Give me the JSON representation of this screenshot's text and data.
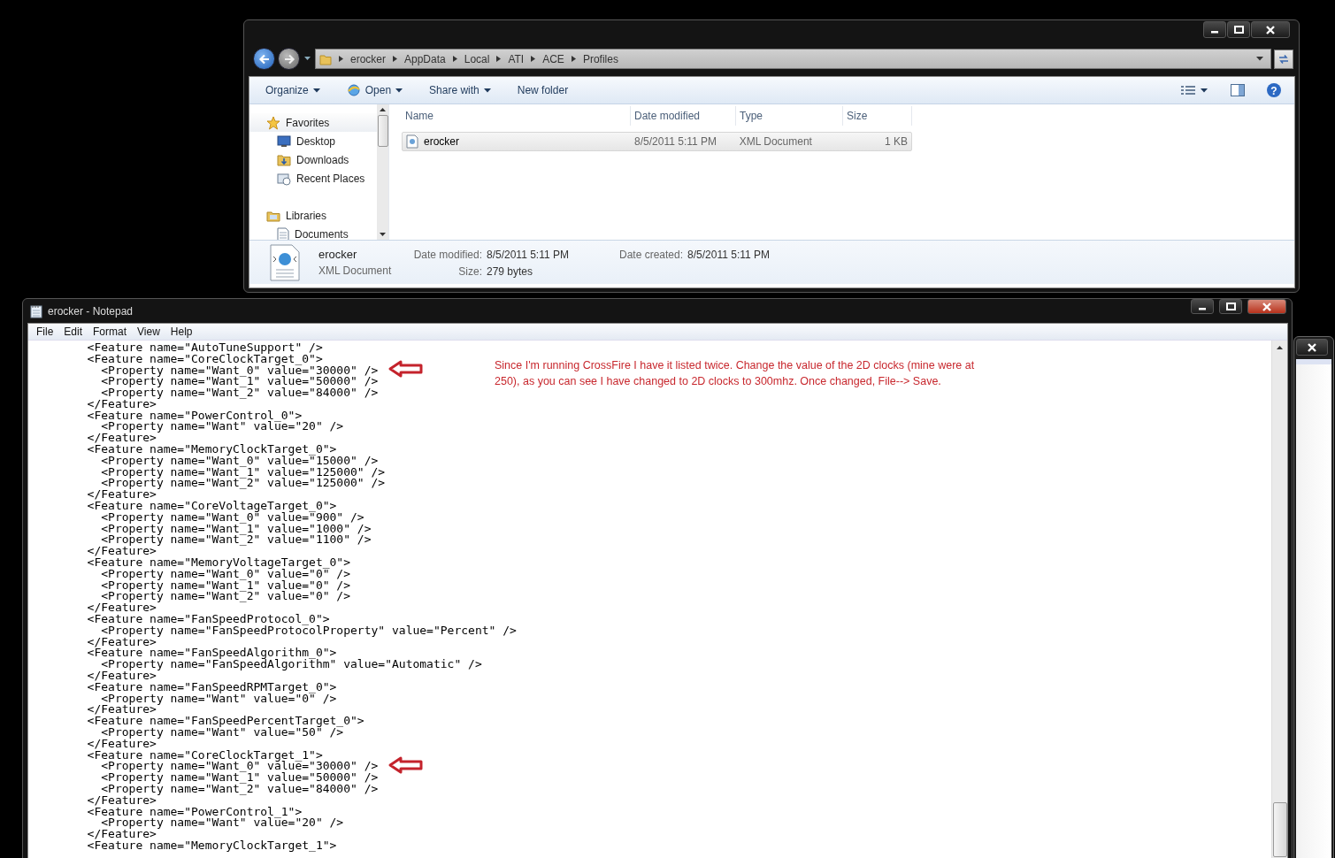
{
  "explorer": {
    "address": [
      "erocker",
      "AppData",
      "Local",
      "ATI",
      "ACE",
      "Profiles"
    ],
    "toolbar": [
      {
        "label": "Organize",
        "kind": "menu"
      },
      {
        "label": "Open",
        "kind": "open"
      },
      {
        "label": "Share with",
        "kind": "menu"
      },
      {
        "label": "New folder",
        "kind": "plain"
      }
    ],
    "nav": [
      {
        "label": "Favorites",
        "kind": "favorites",
        "children": [
          {
            "label": "Desktop",
            "kind": "desktop"
          },
          {
            "label": "Downloads",
            "kind": "downloads"
          },
          {
            "label": "Recent Places",
            "kind": "recent"
          }
        ]
      },
      {
        "label": "Libraries",
        "kind": "libraries",
        "children": [
          {
            "label": "Documents",
            "kind": "documents"
          }
        ]
      }
    ],
    "help_icon": "?",
    "columns": [
      "Name",
      "Date modified",
      "Type",
      "Size"
    ],
    "files": [
      {
        "name": "erocker",
        "date_modified": "8/5/2011 5:11 PM",
        "type": "XML Document",
        "size": "1 KB",
        "selected": true
      }
    ],
    "details": {
      "name": "erocker",
      "type": "XML Document",
      "fields": [
        {
          "label": "Date modified:",
          "value": "8/5/2011 5:11 PM"
        },
        {
          "label": "Date created:",
          "value": "8/5/2011 5:11 PM"
        },
        {
          "label": "Size:",
          "value": "279 bytes"
        }
      ]
    }
  },
  "notepad": {
    "title": "erocker - Notepad",
    "menu": [
      "File",
      "Edit",
      "Format",
      "View",
      "Help"
    ],
    "annotation": "Since I'm running CrossFire I have it listed twice. Change the value of the 2D clocks (mine were at 250), as you can see I have changed to 2D clocks to 300mhz. Once changed, File--> Save.",
    "lines": [
      {
        "text": "        <Feature name=\"AutoTuneSupport\" />",
        "arrow": false
      },
      {
        "text": "        <Feature name=\"CoreClockTarget_0\">",
        "arrow": false
      },
      {
        "text": "          <Property name=\"Want_0\" value=\"30000\" />",
        "arrow": true
      },
      {
        "text": "          <Property name=\"Want_1\" value=\"50000\" />",
        "arrow": false
      },
      {
        "text": "          <Property name=\"Want_2\" value=\"84000\" />",
        "arrow": false
      },
      {
        "text": "        </Feature>",
        "arrow": false
      },
      {
        "text": "        <Feature name=\"PowerControl_0\">",
        "arrow": false
      },
      {
        "text": "          <Property name=\"Want\" value=\"20\" />",
        "arrow": false
      },
      {
        "text": "        </Feature>",
        "arrow": false
      },
      {
        "text": "        <Feature name=\"MemoryClockTarget_0\">",
        "arrow": false
      },
      {
        "text": "          <Property name=\"Want_0\" value=\"15000\" />",
        "arrow": false
      },
      {
        "text": "          <Property name=\"Want_1\" value=\"125000\" />",
        "arrow": false
      },
      {
        "text": "          <Property name=\"Want_2\" value=\"125000\" />",
        "arrow": false
      },
      {
        "text": "        </Feature>",
        "arrow": false
      },
      {
        "text": "        <Feature name=\"CoreVoltageTarget_0\">",
        "arrow": false
      },
      {
        "text": "          <Property name=\"Want_0\" value=\"900\" />",
        "arrow": false
      },
      {
        "text": "          <Property name=\"Want_1\" value=\"1000\" />",
        "arrow": false
      },
      {
        "text": "          <Property name=\"Want_2\" value=\"1100\" />",
        "arrow": false
      },
      {
        "text": "        </Feature>",
        "arrow": false
      },
      {
        "text": "        <Feature name=\"MemoryVoltageTarget_0\">",
        "arrow": false
      },
      {
        "text": "          <Property name=\"Want_0\" value=\"0\" />",
        "arrow": false
      },
      {
        "text": "          <Property name=\"Want_1\" value=\"0\" />",
        "arrow": false
      },
      {
        "text": "          <Property name=\"Want_2\" value=\"0\" />",
        "arrow": false
      },
      {
        "text": "        </Feature>",
        "arrow": false
      },
      {
        "text": "        <Feature name=\"FanSpeedProtocol_0\">",
        "arrow": false
      },
      {
        "text": "          <Property name=\"FanSpeedProtocolProperty\" value=\"Percent\" />",
        "arrow": false
      },
      {
        "text": "        </Feature>",
        "arrow": false
      },
      {
        "text": "        <Feature name=\"FanSpeedAlgorithm_0\">",
        "arrow": false
      },
      {
        "text": "          <Property name=\"FanSpeedAlgorithm\" value=\"Automatic\" />",
        "arrow": false
      },
      {
        "text": "        </Feature>",
        "arrow": false
      },
      {
        "text": "        <Feature name=\"FanSpeedRPMTarget_0\">",
        "arrow": false
      },
      {
        "text": "          <Property name=\"Want\" value=\"0\" />",
        "arrow": false
      },
      {
        "text": "        </Feature>",
        "arrow": false
      },
      {
        "text": "        <Feature name=\"FanSpeedPercentTarget_0\">",
        "arrow": false
      },
      {
        "text": "          <Property name=\"Want\" value=\"50\" />",
        "arrow": false
      },
      {
        "text": "        </Feature>",
        "arrow": false
      },
      {
        "text": "        <Feature name=\"CoreClockTarget_1\">",
        "arrow": false
      },
      {
        "text": "          <Property name=\"Want_0\" value=\"30000\" />",
        "arrow": true
      },
      {
        "text": "          <Property name=\"Want_1\" value=\"50000\" />",
        "arrow": false
      },
      {
        "text": "          <Property name=\"Want_2\" value=\"84000\" />",
        "arrow": false
      },
      {
        "text": "        </Feature>",
        "arrow": false
      },
      {
        "text": "        <Feature name=\"PowerControl_1\">",
        "arrow": false
      },
      {
        "text": "          <Property name=\"Want\" value=\"20\" />",
        "arrow": false
      },
      {
        "text": "        </Feature>",
        "arrow": false
      },
      {
        "text": "        <Feature name=\"MemoryClockTarget_1\">",
        "arrow": false
      }
    ]
  }
}
